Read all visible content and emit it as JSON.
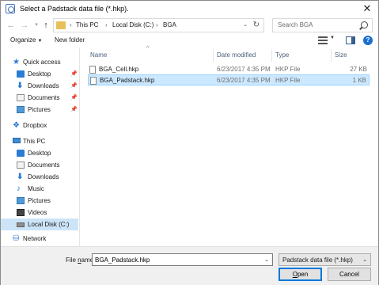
{
  "window": {
    "title": "Select a Padstack data file (*.hkp)."
  },
  "address": {
    "crumbs": [
      "This PC",
      "Local Disk (C:)",
      "BGA"
    ],
    "search_placeholder": "Search BGA"
  },
  "toolbar": {
    "organize": "Organize",
    "new_folder": "New folder",
    "help": "?"
  },
  "nav": {
    "quick_access": "Quick access",
    "quick_items": [
      "Desktop",
      "Downloads",
      "Documents",
      "Pictures"
    ],
    "dropbox": "Dropbox",
    "this_pc": "This PC",
    "pc_items": [
      "Desktop",
      "Documents",
      "Downloads",
      "Music",
      "Pictures",
      "Videos",
      "Local Disk (C:)"
    ],
    "network": "Network"
  },
  "columns": {
    "name": "Name",
    "date": "Date modified",
    "type": "Type",
    "size": "Size"
  },
  "files": [
    {
      "name": "BGA_Cell.hkp",
      "date": "6/23/2017 4:35 PM",
      "type": "HKP File",
      "size": "27 KB"
    },
    {
      "name": "BGA_Padstack.hkp",
      "date": "6/23/2017 4:35 PM",
      "type": "HKP File",
      "size": "1 KB"
    }
  ],
  "footer": {
    "file_name_label_pre": "File ",
    "file_name_label_ul": "n",
    "file_name_label_post": "ame:",
    "file_name_value": "BGA_Padstack.hkp",
    "file_type_value": "Padstack data file (*.hkp)",
    "open_ul": "O",
    "open_rest": "pen",
    "cancel": "Cancel"
  }
}
